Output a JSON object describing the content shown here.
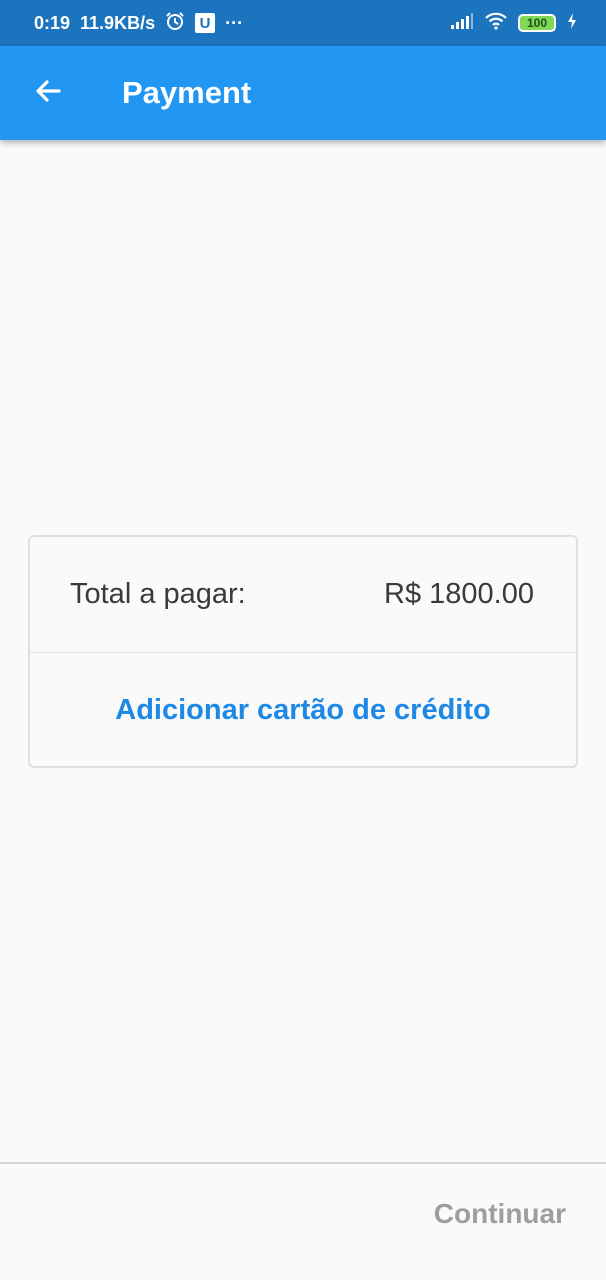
{
  "status_bar": {
    "time": "0:19",
    "speed": "11.9KB/s",
    "alarm_icon": "alarm-icon",
    "u_badge": "U",
    "more": "···",
    "battery": "100"
  },
  "app_bar": {
    "title": "Payment",
    "back_icon": "arrow-left-icon",
    "background": "#2196f3"
  },
  "payment_card": {
    "total_label": "Total a pagar:",
    "total_value": "R$ 1800.00",
    "add_card_label": "Adicionar cartão de crédito",
    "accent": "#1e88e5"
  },
  "footer": {
    "continue_label": "Continuar",
    "disabled_color": "#9e9e9e"
  }
}
